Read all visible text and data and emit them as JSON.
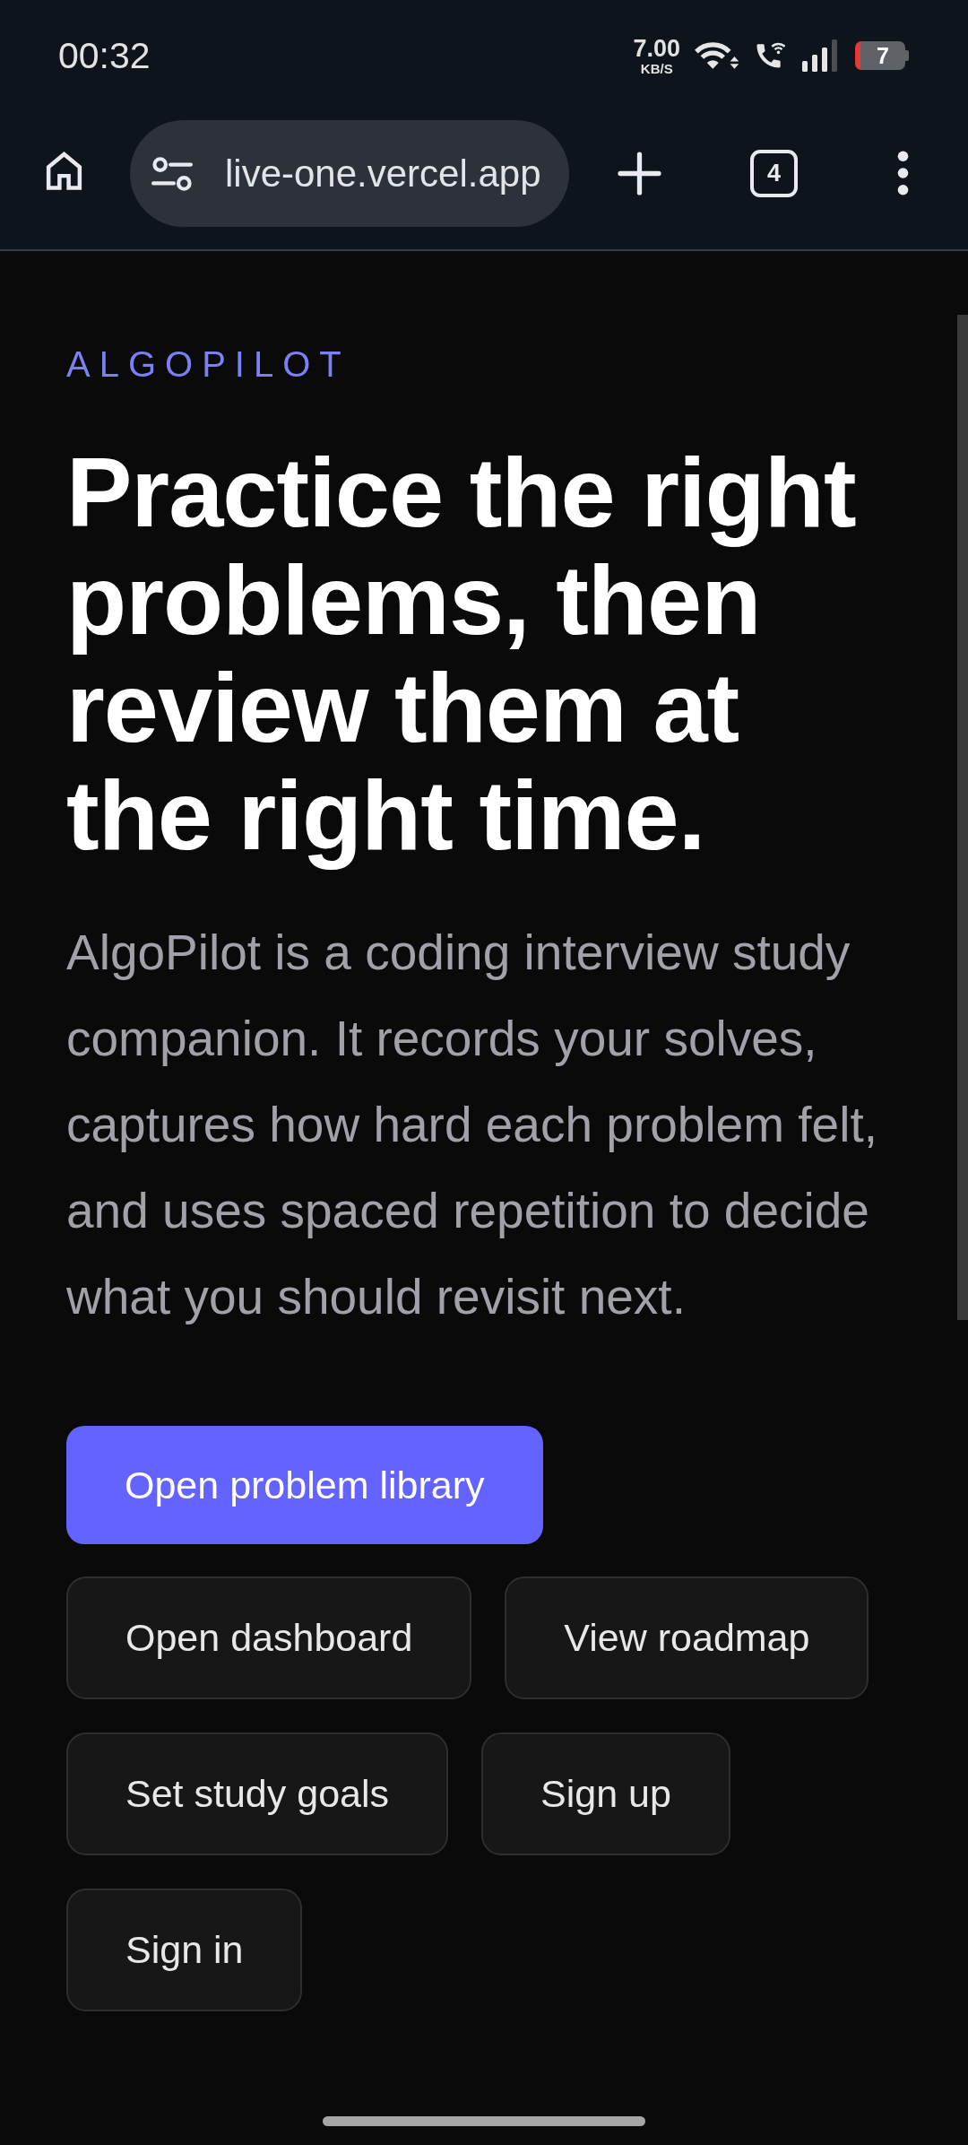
{
  "status_bar": {
    "time": "00:32",
    "net_speed": {
      "value": "7.00",
      "unit": "KB/S"
    },
    "battery": "7"
  },
  "browser_toolbar": {
    "url": "live-one.vercel.app",
    "tab_count": "4"
  },
  "hero": {
    "eyebrow": "ALGOPILOT",
    "headline": "Practice the right problems, then review them at the right time.",
    "description": "AlgoPilot is a coding interview study companion. It records your solves, captures how hard each problem felt, and uses spaced repetition to decide what you should revisit next."
  },
  "actions": [
    {
      "label": "Open problem library",
      "kind": "primary"
    },
    {
      "label": "Open dashboard",
      "kind": "secondary"
    },
    {
      "label": "View roadmap",
      "kind": "secondary"
    },
    {
      "label": "Set study goals",
      "kind": "secondary"
    },
    {
      "label": "Sign up",
      "kind": "secondary"
    },
    {
      "label": "Sign in",
      "kind": "secondary"
    }
  ]
}
